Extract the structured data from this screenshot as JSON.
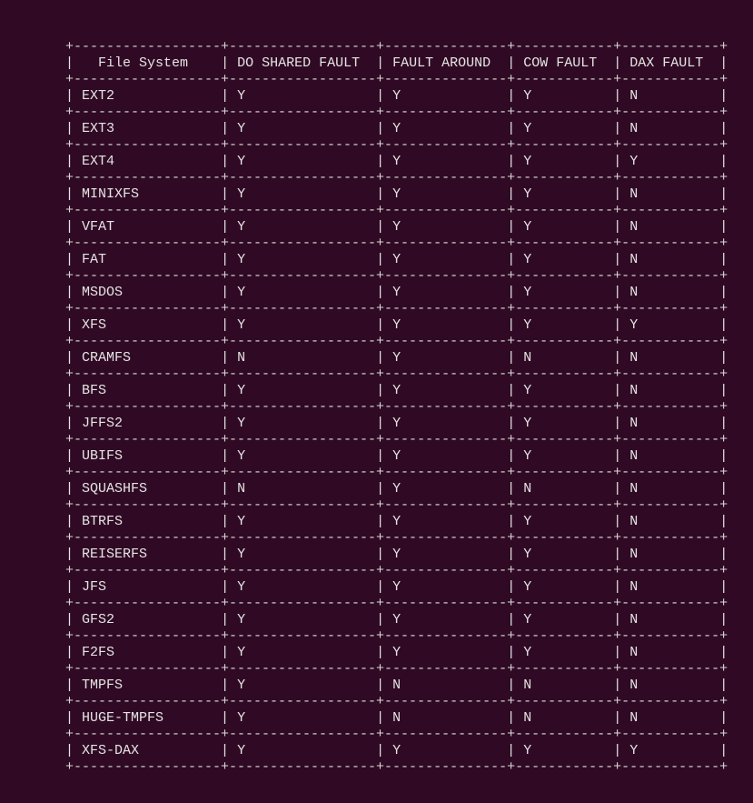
{
  "colors": {
    "background": "#300a24",
    "text": "#e4e4e4"
  },
  "table": {
    "headers": [
      "File System",
      "DO SHARED FAULT",
      "FAULT AROUND",
      "COW FAULT",
      "DAX FAULT"
    ],
    "rows": [
      [
        "EXT2",
        "Y",
        "Y",
        "Y",
        "N"
      ],
      [
        "EXT3",
        "Y",
        "Y",
        "Y",
        "N"
      ],
      [
        "EXT4",
        "Y",
        "Y",
        "Y",
        "Y"
      ],
      [
        "MINIXFS",
        "Y",
        "Y",
        "Y",
        "N"
      ],
      [
        "VFAT",
        "Y",
        "Y",
        "Y",
        "N"
      ],
      [
        "FAT",
        "Y",
        "Y",
        "Y",
        "N"
      ],
      [
        "MSDOS",
        "Y",
        "Y",
        "Y",
        "N"
      ],
      [
        "XFS",
        "Y",
        "Y",
        "Y",
        "Y"
      ],
      [
        "CRAMFS",
        "N",
        "Y",
        "N",
        "N"
      ],
      [
        "BFS",
        "Y",
        "Y",
        "Y",
        "N"
      ],
      [
        "JFFS2",
        "Y",
        "Y",
        "Y",
        "N"
      ],
      [
        "UBIFS",
        "Y",
        "Y",
        "Y",
        "N"
      ],
      [
        "SQUASHFS",
        "N",
        "Y",
        "N",
        "N"
      ],
      [
        "BTRFS",
        "Y",
        "Y",
        "Y",
        "N"
      ],
      [
        "REISERFS",
        "Y",
        "Y",
        "Y",
        "N"
      ],
      [
        "JFS",
        "Y",
        "Y",
        "Y",
        "N"
      ],
      [
        "GFS2",
        "Y",
        "Y",
        "Y",
        "N"
      ],
      [
        "F2FS",
        "Y",
        "Y",
        "Y",
        "N"
      ],
      [
        "TMPFS",
        "Y",
        "N",
        "N",
        "N"
      ],
      [
        "HUGE-TMPFS",
        "Y",
        "N",
        "N",
        "N"
      ],
      [
        "XFS-DAX",
        "Y",
        "Y",
        "Y",
        "Y"
      ]
    ]
  }
}
